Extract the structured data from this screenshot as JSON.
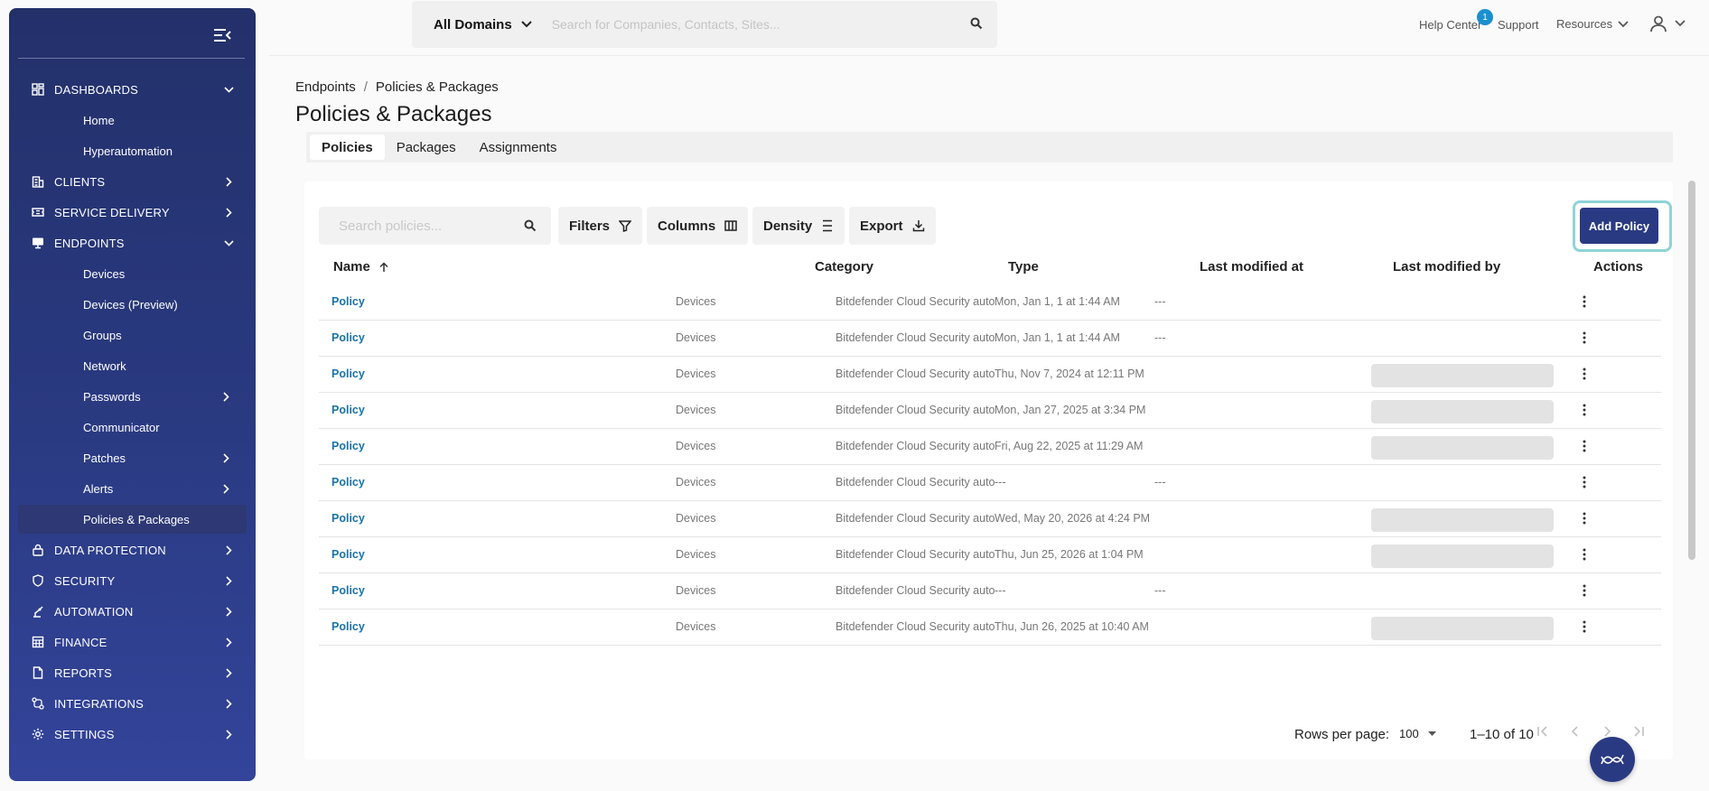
{
  "sidebar": {
    "sections": [
      {
        "label": "DASHBOARDS",
        "icon": "dashboard-icon",
        "expanded": true
      },
      {
        "label": "CLIENTS",
        "icon": "building-icon",
        "expanded": false
      },
      {
        "label": "SERVICE DELIVERY",
        "icon": "ticket-icon",
        "expanded": false
      },
      {
        "label": "ENDPOINTS",
        "icon": "monitor-icon",
        "expanded": true
      },
      {
        "label": "DATA PROTECTION",
        "icon": "lock-icon",
        "expanded": false
      },
      {
        "label": "SECURITY",
        "icon": "shield-icon",
        "expanded": false
      },
      {
        "label": "AUTOMATION",
        "icon": "robot-arm-icon",
        "expanded": false
      },
      {
        "label": "FINANCE",
        "icon": "calculator-icon",
        "expanded": false
      },
      {
        "label": "REPORTS",
        "icon": "report-icon",
        "expanded": false
      },
      {
        "label": "INTEGRATIONS",
        "icon": "integrations-icon",
        "expanded": false
      },
      {
        "label": "SETTINGS",
        "icon": "gear-icon",
        "expanded": false
      }
    ],
    "dashboards_items": [
      "Home",
      "Hyperautomation"
    ],
    "endpoints_items": [
      "Devices",
      "Devices (Preview)",
      "Groups",
      "Network",
      "Passwords",
      "Communicator",
      "Patches",
      "Alerts",
      "Policies & Packages"
    ],
    "active_item": "Policies & Packages"
  },
  "topbar": {
    "domain_selector": "All Domains",
    "search_placeholder": "Search for Companies, Contacts, Sites...",
    "help_center": "Help Center",
    "help_badge": "1",
    "support": "Support",
    "resources": "Resources"
  },
  "breadcrumb": [
    "Endpoints",
    "Policies & Packages"
  ],
  "breadcrumb_sep": "/",
  "page_title": "Policies & Packages",
  "tabs": [
    {
      "label": "Policies",
      "active": true
    },
    {
      "label": "Packages",
      "active": false
    },
    {
      "label": "Assignments",
      "active": false
    }
  ],
  "toolbar": {
    "search_placeholder": "Search policies...",
    "filters": "Filters",
    "columns": "Columns",
    "density": "Density",
    "export": "Export",
    "add_policy": "Add Policy"
  },
  "table": {
    "columns": [
      "Name",
      "Category",
      "Type",
      "Last modified at",
      "Last modified by",
      "Actions"
    ],
    "sort": {
      "column": "Name",
      "direction": "asc"
    },
    "rows": [
      {
        "name": "Policy",
        "category": "Devices",
        "type": "Bitdefender Cloud Security auto",
        "modified_at": "Mon, Jan 1, 1 at 1:44 AM",
        "modified_by": "---",
        "modified_by_loading": false
      },
      {
        "name": "Policy",
        "category": "Devices",
        "type": "Bitdefender Cloud Security auto",
        "modified_at": "Mon, Jan 1, 1 at 1:44 AM",
        "modified_by": "---",
        "modified_by_loading": false
      },
      {
        "name": "Policy",
        "category": "Devices",
        "type": "Bitdefender Cloud Security auto",
        "modified_at": "Thu, Nov 7, 2024 at 12:11 PM",
        "modified_by": "",
        "modified_by_loading": true
      },
      {
        "name": "Policy",
        "category": "Devices",
        "type": "Bitdefender Cloud Security auto",
        "modified_at": "Mon, Jan 27, 2025 at 3:34 PM",
        "modified_by": "",
        "modified_by_loading": true
      },
      {
        "name": "Policy",
        "category": "Devices",
        "type": "Bitdefender Cloud Security auto",
        "modified_at": "Fri, Aug 22, 2025 at 11:29 AM",
        "modified_by": "",
        "modified_by_loading": true
      },
      {
        "name": "Policy",
        "category": "Devices",
        "type": "Bitdefender Cloud Security auto",
        "modified_at": "---",
        "modified_by": "---",
        "modified_by_loading": false
      },
      {
        "name": "Policy",
        "category": "Devices",
        "type": "Bitdefender Cloud Security auto",
        "modified_at": "Wed, May 20, 2026 at 4:24 PM",
        "modified_by": "",
        "modified_by_loading": true
      },
      {
        "name": "Policy",
        "category": "Devices",
        "type": "Bitdefender Cloud Security auto",
        "modified_at": "Thu, Jun 25, 2026 at 1:04 PM",
        "modified_by": "",
        "modified_by_loading": true
      },
      {
        "name": "Policy",
        "category": "Devices",
        "type": "Bitdefender Cloud Security auto",
        "modified_at": "---",
        "modified_by": "---",
        "modified_by_loading": false
      },
      {
        "name": "Policy",
        "category": "Devices",
        "type": "Bitdefender Cloud Security auto",
        "modified_at": "Thu, Jun 26, 2025 at 10:40 AM",
        "modified_by": "",
        "modified_by_loading": true
      }
    ]
  },
  "pagination": {
    "rows_per_page_label": "Rows per page:",
    "rows_per_page_value": "100",
    "range": "1–10 of 10"
  },
  "colors": {
    "sidebar": "#2a3a82",
    "accent": "#2a3a82",
    "link": "#1a72a8",
    "focus_ring": "#8fd3d7"
  }
}
